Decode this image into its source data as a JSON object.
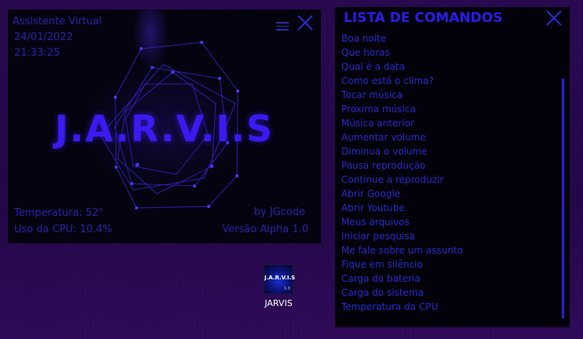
{
  "jarvis": {
    "title": "Assistente Virtual",
    "date": "24/01/2022",
    "time": "21:33:25",
    "logo": "J.A.R.V.I.S",
    "temperature": "Temperatura: 52°",
    "cpu": "Uso da CPU: 10.4%",
    "author": "by JGcode",
    "version": "Versão Alpha 1.0",
    "menu_icon": "hamburger-icon",
    "close_icon": "close-icon"
  },
  "commands": {
    "title": "LISTA DE COMANDOS",
    "close_icon": "close-icon",
    "items": [
      "Boa noite",
      "Que horas",
      "Qual é a data",
      "Como está o clima?",
      "Tocar música",
      "Proxima música",
      "Música anterior",
      "Aumentar volume",
      "Diminua o volume",
      "Pausa reprodução",
      "Continue a reproduzir",
      "Abrir Google",
      "Abrir Youtube",
      "Meus arquivos",
      "Iniciar pesquisa",
      "Me fale sobre um assunto",
      "Fique em silêncio",
      "Carga da bateria",
      "Carga do sistema",
      "Temperatura da CPU"
    ]
  },
  "desktop": {
    "icon_label": "JARVIS",
    "icon_image_text": "J.A.R.V.I.S",
    "icon_image_subtext": "1.0"
  },
  "colors": {
    "accent": "#2d1be8",
    "text_dim": "#2c20a8",
    "window_bg": "#05030f",
    "desktop_bg": "#2a0a52"
  }
}
